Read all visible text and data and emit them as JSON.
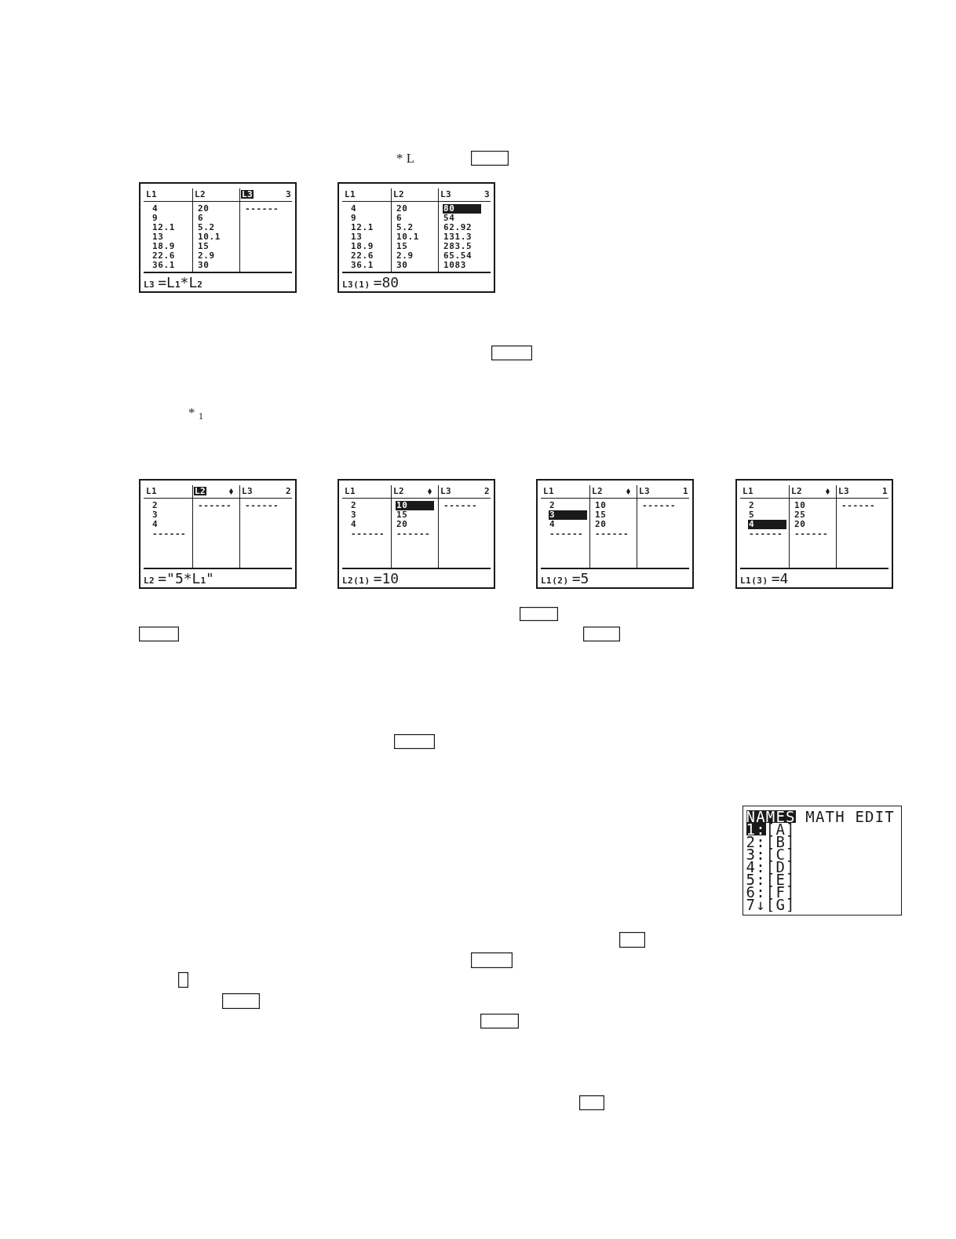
{
  "text_fragments": [
    {
      "text": "* L"
    },
    {
      "text": "* $_{1}$"
    }
  ],
  "list_screens": [
    {
      "columns": [
        {
          "name": "L1",
          "selected": false,
          "locked": false,
          "cells": [
            {
              "value": "4",
              "selected": false
            },
            {
              "value": "9",
              "selected": false
            },
            {
              "value": "12.1",
              "selected": false
            },
            {
              "value": "13",
              "selected": false
            },
            {
              "value": "18.9",
              "selected": false
            },
            {
              "value": "22.6",
              "selected": false
            },
            {
              "value": "36.1",
              "selected": false
            }
          ]
        },
        {
          "name": "L2",
          "selected": false,
          "locked": false,
          "cells": [
            {
              "value": "20",
              "selected": false
            },
            {
              "value": "6",
              "selected": false
            },
            {
              "value": "5.2",
              "selected": false
            },
            {
              "value": "10.1",
              "selected": false
            },
            {
              "value": "15",
              "selected": false
            },
            {
              "value": "2.9",
              "selected": false
            },
            {
              "value": "30",
              "selected": false
            }
          ]
        },
        {
          "name": "L3",
          "selected": true,
          "locked": false,
          "cells": [
            {
              "value": "------",
              "selected": false
            }
          ]
        }
      ],
      "column_number": "3",
      "prompt": "L3",
      "entry": "=L$_{1}$*L$_{2}$"
    },
    {
      "columns": [
        {
          "name": "L1",
          "selected": false,
          "locked": false,
          "cells": [
            {
              "value": "4",
              "selected": false
            },
            {
              "value": "9",
              "selected": false
            },
            {
              "value": "12.1",
              "selected": false
            },
            {
              "value": "13",
              "selected": false
            },
            {
              "value": "18.9",
              "selected": false
            },
            {
              "value": "22.6",
              "selected": false
            },
            {
              "value": "36.1",
              "selected": false
            }
          ]
        },
        {
          "name": "L2",
          "selected": false,
          "locked": false,
          "cells": [
            {
              "value": "20",
              "selected": false
            },
            {
              "value": "6",
              "selected": false
            },
            {
              "value": "5.2",
              "selected": false
            },
            {
              "value": "10.1",
              "selected": false
            },
            {
              "value": "15",
              "selected": false
            },
            {
              "value": "2.9",
              "selected": false
            },
            {
              "value": "30",
              "selected": false
            }
          ]
        },
        {
          "name": "L3",
          "selected": false,
          "locked": false,
          "cells": [
            {
              "value": "80",
              "selected": true
            },
            {
              "value": "54",
              "selected": false
            },
            {
              "value": "62.92",
              "selected": false
            },
            {
              "value": "131.3",
              "selected": false
            },
            {
              "value": "283.5",
              "selected": false
            },
            {
              "value": "65.54",
              "selected": false
            },
            {
              "value": "1083",
              "selected": false
            }
          ]
        }
      ],
      "column_number": "3",
      "prompt": "L3(1)",
      "entry": "=80"
    },
    {
      "columns": [
        {
          "name": "L1",
          "selected": false,
          "locked": false,
          "cells": [
            {
              "value": "2",
              "selected": false
            },
            {
              "value": "3",
              "selected": false
            },
            {
              "value": "4",
              "selected": false
            },
            {
              "value": "------",
              "selected": false
            }
          ]
        },
        {
          "name": "L2",
          "selected": true,
          "locked": true,
          "cells": [
            {
              "value": "------",
              "selected": false
            }
          ]
        },
        {
          "name": "L3",
          "selected": false,
          "locked": false,
          "cells": [
            {
              "value": "------",
              "selected": false
            }
          ]
        }
      ],
      "column_number": "2",
      "prompt": "L2",
      "entry": "=\"5*L$_{1}$\""
    },
    {
      "columns": [
        {
          "name": "L1",
          "selected": false,
          "locked": false,
          "cells": [
            {
              "value": "2",
              "selected": false
            },
            {
              "value": "3",
              "selected": false
            },
            {
              "value": "4",
              "selected": false
            },
            {
              "value": "------",
              "selected": false
            }
          ]
        },
        {
          "name": "L2",
          "selected": false,
          "locked": true,
          "cells": [
            {
              "value": "10",
              "selected": true
            },
            {
              "value": "15",
              "selected": false
            },
            {
              "value": "20",
              "selected": false
            },
            {
              "value": "------",
              "selected": false
            }
          ]
        },
        {
          "name": "L3",
          "selected": false,
          "locked": false,
          "cells": [
            {
              "value": "------",
              "selected": false
            }
          ]
        }
      ],
      "column_number": "2",
      "prompt": "L2(1)",
      "entry": "=10"
    },
    {
      "columns": [
        {
          "name": "L1",
          "selected": false,
          "locked": false,
          "cells": [
            {
              "value": "2",
              "selected": false
            },
            {
              "value": "3",
              "selected": true
            },
            {
              "value": "4",
              "selected": false
            },
            {
              "value": "------",
              "selected": false
            }
          ]
        },
        {
          "name": "L2",
          "selected": false,
          "locked": true,
          "cells": [
            {
              "value": "10",
              "selected": false
            },
            {
              "value": "15",
              "selected": false
            },
            {
              "value": "20",
              "selected": false
            },
            {
              "value": "------",
              "selected": false
            }
          ]
        },
        {
          "name": "L3",
          "selected": false,
          "locked": false,
          "cells": [
            {
              "value": "------",
              "selected": false
            }
          ]
        }
      ],
      "column_number": "1",
      "prompt": "L1(2)",
      "entry": "=5"
    },
    {
      "columns": [
        {
          "name": "L1",
          "selected": false,
          "locked": false,
          "cells": [
            {
              "value": "2",
              "selected": false
            },
            {
              "value": "5",
              "selected": false
            },
            {
              "value": "4",
              "selected": true
            },
            {
              "value": "------",
              "selected": false
            }
          ]
        },
        {
          "name": "L2",
          "selected": false,
          "locked": true,
          "cells": [
            {
              "value": "10",
              "selected": false
            },
            {
              "value": "25",
              "selected": false
            },
            {
              "value": "20",
              "selected": false
            },
            {
              "value": "------",
              "selected": false
            }
          ]
        },
        {
          "name": "L3",
          "selected": false,
          "locked": false,
          "cells": [
            {
              "value": "------",
              "selected": false
            }
          ]
        }
      ],
      "column_number": "1",
      "prompt": "L1(3)",
      "entry": "=4"
    }
  ],
  "matrix_screen": {
    "tabs": [
      {
        "label": "NAMES",
        "selected": true
      },
      {
        "label": "MATH",
        "selected": false
      },
      {
        "label": "EDIT",
        "selected": false
      }
    ],
    "items": [
      {
        "number": "1:",
        "label": "[A]",
        "selected": true
      },
      {
        "number": "2:",
        "label": "[B]",
        "selected": false
      },
      {
        "number": "3:",
        "label": "[C]",
        "selected": false
      },
      {
        "number": "4:",
        "label": "[D]",
        "selected": false
      },
      {
        "number": "5:",
        "label": "[E]",
        "selected": false
      },
      {
        "number": "6:",
        "label": "[F]",
        "selected": false
      },
      {
        "number": "7↓",
        "label": "[G]",
        "selected": false
      }
    ]
  }
}
